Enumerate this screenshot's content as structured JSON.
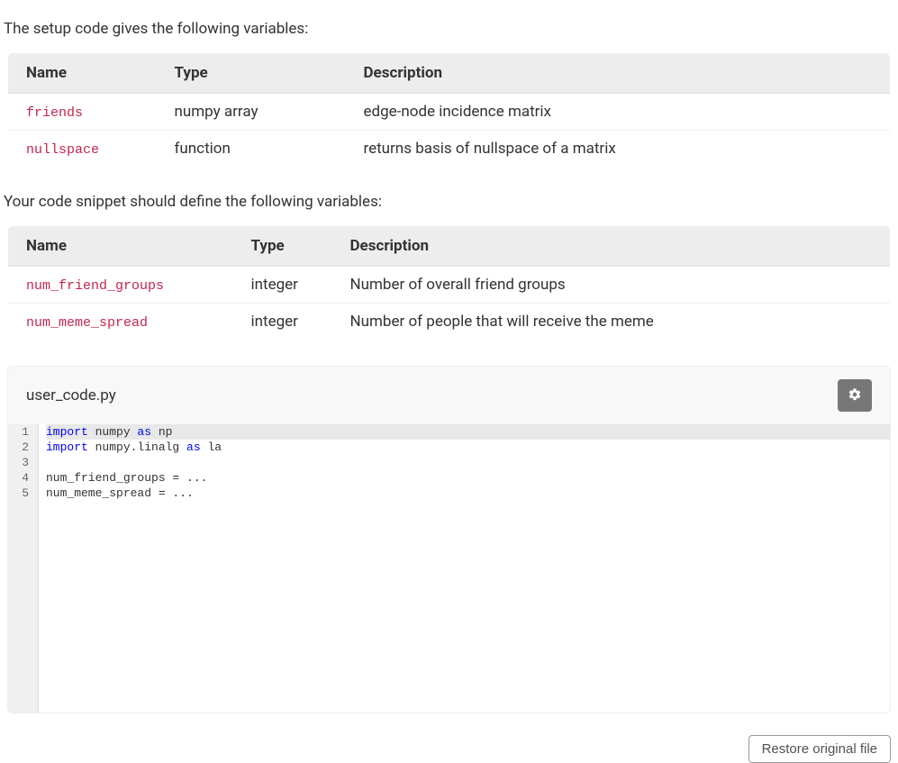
{
  "intro1": "The setup code gives the following variables:",
  "table1": {
    "headers": {
      "name": "Name",
      "type": "Type",
      "desc": "Description"
    },
    "rows": [
      {
        "name": "friends",
        "type": "numpy array",
        "desc": "edge-node incidence matrix"
      },
      {
        "name": "nullspace",
        "type": "function",
        "desc": "returns basis of nullspace of a matrix"
      }
    ]
  },
  "intro2": "Your code snippet should define the following variables:",
  "table2": {
    "headers": {
      "name": "Name",
      "type": "Type",
      "desc": "Description"
    },
    "rows": [
      {
        "name": "num_friend_groups",
        "type": "integer",
        "desc": "Number of overall friend groups"
      },
      {
        "name": "num_meme_spread",
        "type": "integer",
        "desc": "Number of people that will receive the meme"
      }
    ]
  },
  "editor": {
    "filename": "user_code.py",
    "lines": [
      "import numpy as np",
      "import numpy.linalg as la",
      "",
      "num_friend_groups = ...",
      "num_meme_spread = ..."
    ],
    "line_numbers": [
      "1",
      "2",
      "3",
      "4",
      "5"
    ]
  },
  "buttons": {
    "restore": "Restore original file"
  }
}
